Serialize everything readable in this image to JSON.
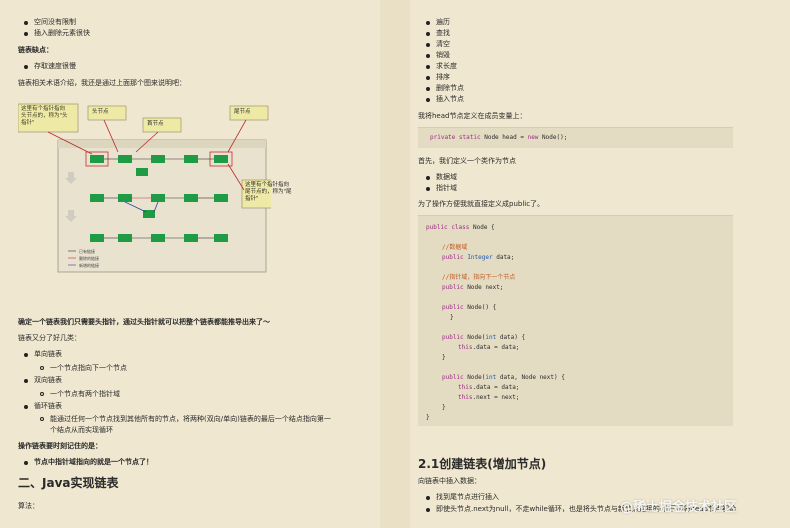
{
  "left": {
    "top_bullets": [
      "空间没有限制",
      "插入删除元素很快"
    ],
    "disadvantage_title": "链表缺点：",
    "disadvantage_bullets": [
      "存取速度很慢"
    ],
    "intro": "链表相关术语介绍，我还是通过上面那个图来说明吧：",
    "figure": {
      "callout_head_pointer": [
        "这里有个指针指向",
        "头节点的，称为\"头",
        "指针\""
      ],
      "callout_head_node": "头节点",
      "callout_first_node": "首节点",
      "callout_tail_node": "尾节点",
      "callout_tail_pointer": [
        "这里有个指针指向",
        "尾节点的，称为\"尾",
        "指针\""
      ],
      "legend": [
        "已有链接",
        "删除的链接",
        "新增的链接"
      ]
    },
    "summary": "确定一个链表我们只需要头指针，通过头指针就可以把整个链表都能推导出来了～",
    "types_intro": "链表又分了好几类：",
    "types": [
      {
        "label": "单向链表",
        "sub": "一个节点指向下一个节点"
      },
      {
        "label": "双向链表",
        "sub": "一个节点有两个指针域"
      },
      {
        "label": "循环链表",
        "sub": "能通过任何一个节点找到其他所有的节点，将两种(双向/单向)链表的最后一个结点指向第一",
        "sub2": "个结点从而实现循环"
      }
    ],
    "remember_title": "操作链表要时刻记住的是：",
    "remember_bullet": "节点中指针域指向的就是一个节点了！",
    "section_title": "二、Java实现链表",
    "algo": "算法："
  },
  "right": {
    "ops": [
      "遍历",
      "查找",
      "清空",
      "销毁",
      "求长度",
      "排序",
      "删除节点",
      "插入节点"
    ],
    "head_text": "我将head节点定义在成员变量上：",
    "head_code": "private static Node head = new Node();",
    "node_intro": "首先，我们定义一个类作为节点",
    "node_bullets": [
      "数据域",
      "指针域"
    ],
    "public_note": "为了操作方便我就直接定义成public了。",
    "section": "2.1创建链表(增加节点)",
    "insert_intro": "向链表中插入数据：",
    "insert_bullets": [
      "找到尾节点进行插入",
      "即使头节点.next为null，不走while循环，也是将头节点与新节点连接的(我已经将head节点初始"
    ]
  },
  "code_lines": {
    "l1": "public class Node {",
    "c1": "//数据域",
    "l2": "public Integer data;",
    "c2": "//指针域，指向下一个节点",
    "l3": "public Node next;",
    "l4": "public Node() {",
    "close": "}",
    "l5": "public Node(int data) {",
    "l6": "this.data = data;",
    "l7": "public Node(int data, Node next) {",
    "l8": "this.next = next;"
  },
  "watermark": "@稀土掘金技术社区"
}
